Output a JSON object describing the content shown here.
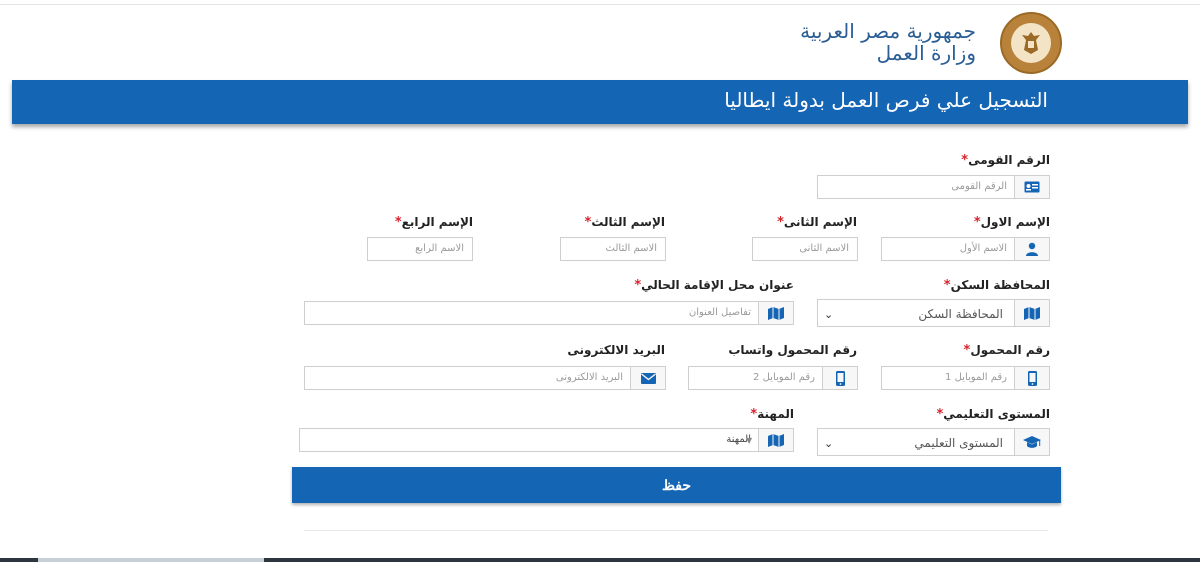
{
  "header": {
    "country": "جمهورية مصر العربية",
    "ministry": "وزارة العمل",
    "logo_icon": "ministry-of-labour-seal"
  },
  "banner": {
    "title": "التسجيل علي فرص العمل بدولة ايطاليا"
  },
  "form": {
    "national_id": {
      "label": "الرقم القومى",
      "placeholder": "الرقم القومى",
      "icon": "id-card-icon"
    },
    "first_name": {
      "label": "الإسم الاول",
      "placeholder": "الاسم الأول",
      "icon": "user-icon"
    },
    "second_name": {
      "label": "الإسم الثانى",
      "placeholder": "الاسم الثانى"
    },
    "third_name": {
      "label": "الإسم الثالث",
      "placeholder": "الاسم الثالث"
    },
    "fourth_name": {
      "label": "الإسم الرابع",
      "placeholder": "الاسم الرابع"
    },
    "governorate": {
      "label": "المحافظة السكن",
      "value": "المحافظة السكن",
      "icon": "map-icon"
    },
    "address": {
      "label": "عنوان محل الإقامة الحالي",
      "placeholder": "تفاصيل العنوان",
      "icon": "map-icon"
    },
    "mobile": {
      "label": "رقم المحمول",
      "placeholder": "رقم الموبايل 1",
      "icon": "mobile-icon"
    },
    "whatsapp": {
      "label": "رقم المحمول واتساب",
      "placeholder": "رقم الموبايل 2",
      "icon": "mobile-icon"
    },
    "email": {
      "label": "البريد الالكترونى",
      "placeholder": "البريد الالكترونى",
      "icon": "envelope-icon"
    },
    "education": {
      "label": "المستوى التعليمي",
      "value": "المستوى التعليمي",
      "icon": "graduation-cap-icon"
    },
    "profession": {
      "label": "المهنة",
      "value": "المهنة",
      "icon": "map-icon"
    },
    "required_mark": "*"
  },
  "actions": {
    "save_label": "حفظ"
  },
  "colors": {
    "primary": "#1565b5",
    "required": "#d9232d",
    "header_text": "#2a5e95"
  }
}
